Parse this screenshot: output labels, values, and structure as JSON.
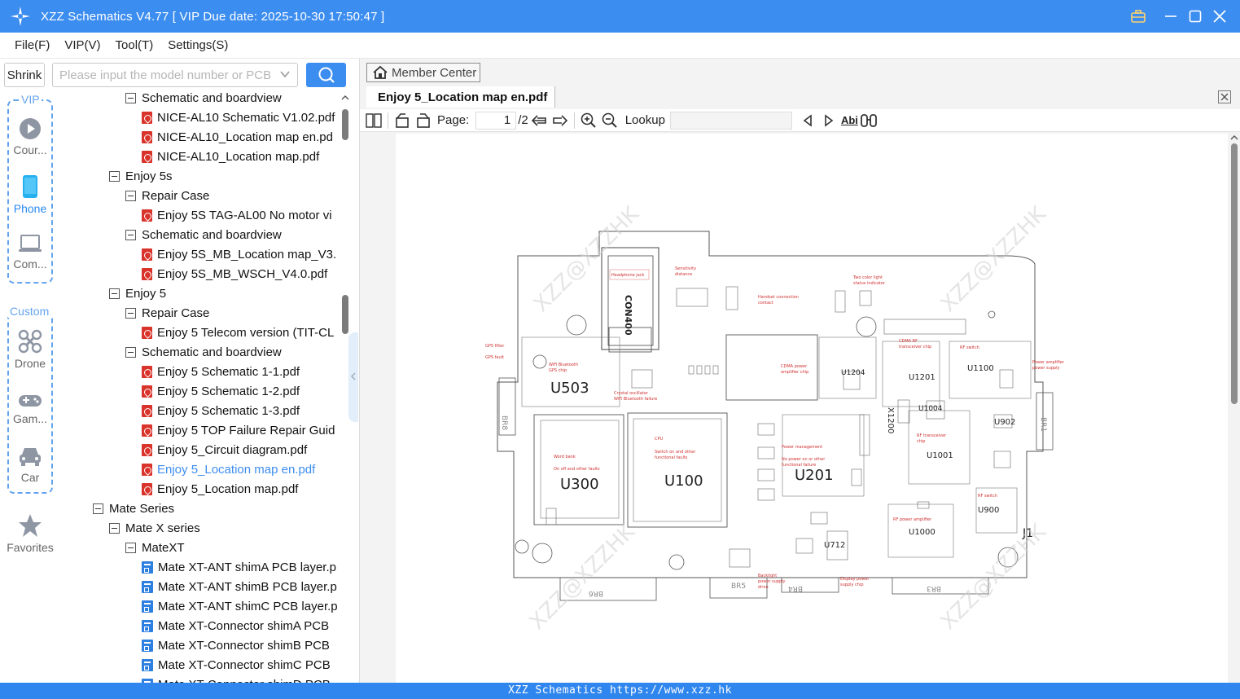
{
  "window": {
    "title": "XZZ Schematics V4.77 [ VIP Due date: 2025-10-30 17:50:47 ]"
  },
  "menu": [
    "File(F)",
    "VIP(V)",
    "Tool(T)",
    "Settings(S)"
  ],
  "search": {
    "shrink_label": "Shrink",
    "placeholder": "Please input the model number or PCB"
  },
  "rail": {
    "vip_label": "VIP",
    "custom_label": "Custom",
    "items": [
      {
        "label": "Cour...",
        "icon": "play-icon"
      },
      {
        "label": "Phone",
        "icon": "phone-icon"
      },
      {
        "label": "Com...",
        "icon": "laptop-icon"
      },
      {
        "label": "Drone",
        "icon": "drone-icon"
      },
      {
        "label": "Gam...",
        "icon": "gamepad-icon"
      },
      {
        "label": "Car",
        "icon": "car-icon"
      },
      {
        "label": "Favorites",
        "icon": "star-icon"
      }
    ]
  },
  "tree": [
    {
      "level": 2,
      "kind": "folder",
      "label": "Schematic and boardview"
    },
    {
      "level": 3,
      "kind": "pdf",
      "label": "NICE-AL10 Schematic V1.02.pdf"
    },
    {
      "level": 3,
      "kind": "pdf",
      "label": "NICE-AL10_Location map en.pd"
    },
    {
      "level": 3,
      "kind": "pdf",
      "label": "NICE-AL10_Location map.pdf"
    },
    {
      "level": 1,
      "kind": "folder",
      "label": "Enjoy 5s"
    },
    {
      "level": 2,
      "kind": "folder",
      "label": "Repair Case"
    },
    {
      "level": 3,
      "kind": "pdf",
      "label": "Enjoy 5S TAG-AL00 No motor vi"
    },
    {
      "level": 2,
      "kind": "folder",
      "label": "Schematic and boardview"
    },
    {
      "level": 3,
      "kind": "pdf",
      "label": "Enjoy 5S_MB_Location map_V3."
    },
    {
      "level": 3,
      "kind": "pdf",
      "label": "Enjoy 5S_MB_WSCH_V4.0.pdf"
    },
    {
      "level": 1,
      "kind": "folder",
      "label": "Enjoy 5"
    },
    {
      "level": 2,
      "kind": "folder",
      "label": "Repair Case"
    },
    {
      "level": 3,
      "kind": "pdf",
      "label": "Enjoy 5 Telecom version (TIT-CL"
    },
    {
      "level": 2,
      "kind": "folder",
      "label": "Schematic and boardview"
    },
    {
      "level": 3,
      "kind": "pdf",
      "label": "Enjoy 5 Schematic 1-1.pdf"
    },
    {
      "level": 3,
      "kind": "pdf",
      "label": "Enjoy 5 Schematic 1-2.pdf"
    },
    {
      "level": 3,
      "kind": "pdf",
      "label": "Enjoy 5 Schematic 1-3.pdf"
    },
    {
      "level": 3,
      "kind": "pdf",
      "label": "Enjoy 5 TOP Failure Repair Guid"
    },
    {
      "level": 3,
      "kind": "pdf",
      "label": "Enjoy 5_Circuit diagram.pdf"
    },
    {
      "level": 3,
      "kind": "pdf",
      "label": "Enjoy 5_Location map en.pdf",
      "selected": true
    },
    {
      "level": 3,
      "kind": "pdf",
      "label": "Enjoy 5_Location map.pdf"
    },
    {
      "level": 0,
      "kind": "folder",
      "label": "Mate Series"
    },
    {
      "level": 1,
      "kind": "folder",
      "label": "Mate X series"
    },
    {
      "level": 2,
      "kind": "folder",
      "label": "MateXT"
    },
    {
      "level": 3,
      "kind": "pcb",
      "label": "Mate XT-ANT shimA PCB layer.p"
    },
    {
      "level": 3,
      "kind": "pcb",
      "label": "Mate XT-ANT shimB PCB layer.p"
    },
    {
      "level": 3,
      "kind": "pcb",
      "label": "Mate XT-ANT shimC PCB layer.p"
    },
    {
      "level": 3,
      "kind": "pcb",
      "label": "Mate XT-Connector shimA PCB"
    },
    {
      "level": 3,
      "kind": "pcb",
      "label": "Mate XT-Connector shimB PCB"
    },
    {
      "level": 3,
      "kind": "pcb",
      "label": "Mate XT-Connector shimC PCB"
    },
    {
      "level": 3,
      "kind": "pcb",
      "label": "Mate XT-Connector shimD PCB"
    }
  ],
  "viewer": {
    "member_center": "Member Center",
    "tab_title": "Enjoy 5_Location map en.pdf",
    "page_label": "Page:",
    "page_current": "1",
    "page_total": "/2",
    "lookup_label": "Lookup",
    "abi_label": "Abi"
  },
  "schematic": {
    "watermark": "XZZ@XZZHK",
    "components": [
      "CON400",
      "U503",
      "U300",
      "U100",
      "U201",
      "U1201",
      "U1204",
      "U1100",
      "X1200",
      "U1004",
      "U1001",
      "U1000",
      "U902",
      "U900",
      "U712",
      "J1",
      "BR8",
      "BR6",
      "BR5",
      "BR4",
      "BR3",
      "BR1"
    ],
    "annotations": [
      "Headphone jack",
      "Sensitivity distance",
      "Handset connection contact",
      "Two color light status indicator",
      "GPS filter",
      "GPS fault",
      "WiFi Bluetooth GPS chip",
      "Crystal oscillator WiFi Bluetooth failure",
      "CDMA power amplifier chip",
      "CDMA RF transceiver chip",
      "RF switch",
      "Power amplifier power supply",
      "Word bank",
      "On off and other faults",
      "CPU",
      "Switch on and other functional faults",
      "Power management",
      "No power on or other functional failure",
      "RF transceiver chip",
      "RF power amplifier",
      "RF switch",
      "Backlight power supply drive",
      "Display power supply chip"
    ]
  },
  "status": {
    "text": "XZZ Schematics https://www.xzz.hk"
  },
  "colors": {
    "accent": "#3c8df0",
    "pdf_icon": "#d9342b",
    "pcb_icon": "#2d7fe0",
    "selected_text": "#3c8df0"
  }
}
